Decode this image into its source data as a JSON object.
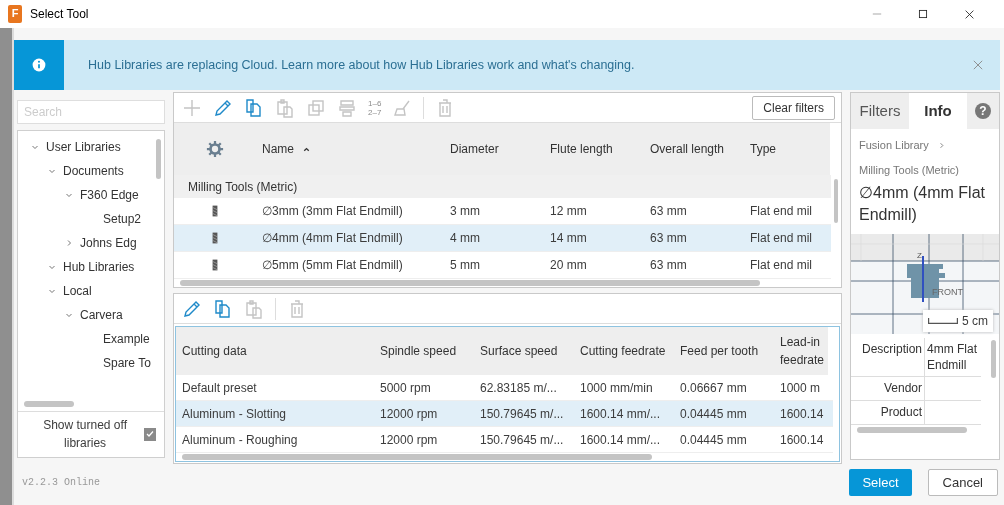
{
  "window": {
    "title": "Select Tool",
    "app_icon_letter": "F"
  },
  "banner": {
    "text": "Hub Libraries are replacing Cloud. Learn more about how Hub Libraries work and what's changing."
  },
  "library_search": {
    "placeholder": "Search"
  },
  "library_tree": [
    {
      "label": "User Libraries",
      "expanded": true,
      "children": [
        {
          "label": "Documents",
          "expanded": true,
          "children": [
            {
              "label": "F360 Edge",
              "expanded": true,
              "children": [
                {
                  "label": "Setup2"
                }
              ]
            },
            {
              "label": "Johns Edg",
              "expanded": false
            }
          ]
        },
        {
          "label": "Hub Libraries",
          "expanded": true
        },
        {
          "label": "Local",
          "expanded": true,
          "children": [
            {
              "label": "Carvera",
              "expanded": true,
              "children": [
                {
                  "label": "Example"
                },
                {
                  "label": "Spare To"
                }
              ]
            }
          ]
        }
      ]
    }
  ],
  "show_turned_off": {
    "label": "Show turned off libraries",
    "checked": true
  },
  "version": "v2.2.3 Online",
  "tools_toolbar": [
    {
      "kind": "add",
      "enabled": false
    },
    {
      "kind": "edit",
      "enabled": true
    },
    {
      "kind": "copy",
      "enabled": true
    },
    {
      "kind": "paste",
      "enabled": false
    },
    {
      "kind": "duplicate",
      "enabled": false
    },
    {
      "kind": "holder",
      "enabled": false
    },
    {
      "kind": "renumber",
      "enabled": false,
      "lines": [
        "1–6",
        "2–7"
      ]
    },
    {
      "kind": "cleanup",
      "enabled": false
    },
    {
      "kind": "separator"
    },
    {
      "kind": "delete",
      "enabled": false
    }
  ],
  "clear_filters_button": "Clear filters",
  "tools_table": {
    "columns": [
      {
        "label": "Name",
        "sorted": true
      },
      {
        "label": "Diameter",
        "sorted": false
      },
      {
        "label": "Flute length",
        "sorted": false
      },
      {
        "label": "Overall length",
        "sorted": false
      },
      {
        "label": "Type",
        "sorted": false
      }
    ],
    "group": "Milling Tools (Metric)",
    "rows": [
      {
        "selected": false,
        "cells": [
          "∅3mm (3mm Flat Endmill)",
          "3 mm",
          "12 mm",
          "63 mm",
          "Flat end mil"
        ]
      },
      {
        "selected": true,
        "cells": [
          "∅4mm (4mm Flat Endmill)",
          "4 mm",
          "14 mm",
          "63 mm",
          "Flat end mil"
        ]
      },
      {
        "selected": false,
        "cells": [
          "∅5mm (5mm Flat Endmill)",
          "5 mm",
          "20 mm",
          "63 mm",
          "Flat end mil"
        ]
      }
    ]
  },
  "cutting_toolbar": [
    {
      "kind": "edit",
      "enabled": true
    },
    {
      "kind": "copy",
      "enabled": true
    },
    {
      "kind": "paste",
      "enabled": false
    },
    {
      "kind": "separator"
    },
    {
      "kind": "delete",
      "enabled": false
    }
  ],
  "cutting_table": {
    "columns": [
      "Cutting data",
      "Spindle speed",
      "Surface speed",
      "Cutting feedrate",
      "Feed per tooth",
      "Lead-in feedrate"
    ],
    "rows": [
      {
        "selected": false,
        "cells": [
          "Default preset",
          "5000 rpm",
          "62.83185 m/...",
          "1000 mm/min",
          "0.06667 mm",
          "1000 m"
        ]
      },
      {
        "selected": true,
        "cells": [
          "Aluminum - Slotting",
          "12000 rpm",
          "150.79645 m/...",
          "1600.14 mm/...",
          "0.04445 mm",
          "1600.14"
        ]
      },
      {
        "selected": false,
        "cells": [
          "Aluminum - Roughing",
          "12000 rpm",
          "150.79645 m/...",
          "1600.14 mm/...",
          "0.04445 mm",
          "1600.14"
        ]
      }
    ]
  },
  "side_tabs": [
    {
      "label": "Filters",
      "selected": false
    },
    {
      "label": "Info",
      "selected": true
    }
  ],
  "help_glyph": "?",
  "info": {
    "breadcrumb": [
      "Fusion Library",
      "Milling Tools (Metric)"
    ],
    "title": "∅4mm (4mm Flat Endmill)",
    "preview": {
      "axis_label": "Z",
      "view_label": "FRONT",
      "scale": "5 cm"
    },
    "properties": [
      {
        "name": "Description",
        "value": "4mm Flat Endmill"
      },
      {
        "name": "Vendor"
      },
      {
        "name": "Product"
      }
    ]
  },
  "buttons": [
    {
      "label": "Select",
      "kind": "primary"
    },
    {
      "label": "Cancel",
      "kind": "secondary"
    }
  ]
}
